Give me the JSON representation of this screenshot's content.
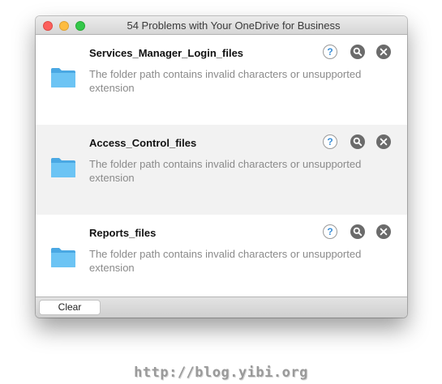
{
  "window": {
    "title": "54 Problems with Your OneDrive for Business"
  },
  "icons": {
    "folder": "folder-icon",
    "help": "help-icon",
    "find": "magnifier-icon",
    "remove": "close-circle-icon"
  },
  "colors": {
    "folder": "#5ab8ef",
    "help_glyph": "#3b8fd8",
    "action_circle": "#6b6b6b",
    "row_alt": "#f2f2f2"
  },
  "problems": [
    {
      "name": "Services_Manager_Login_files",
      "message": "The folder path contains invalid characters or unsupported extension",
      "help_glyph": "?"
    },
    {
      "name": "Access_Control_files",
      "message": "The folder path contains invalid characters or unsupported extension",
      "help_glyph": "?"
    },
    {
      "name": "Reports_files",
      "message": "The folder path contains invalid characters or unsupported extension",
      "help_glyph": "?"
    }
  ],
  "footer": {
    "clear_label": "Clear"
  },
  "watermark": "http://blog.yibi.org"
}
